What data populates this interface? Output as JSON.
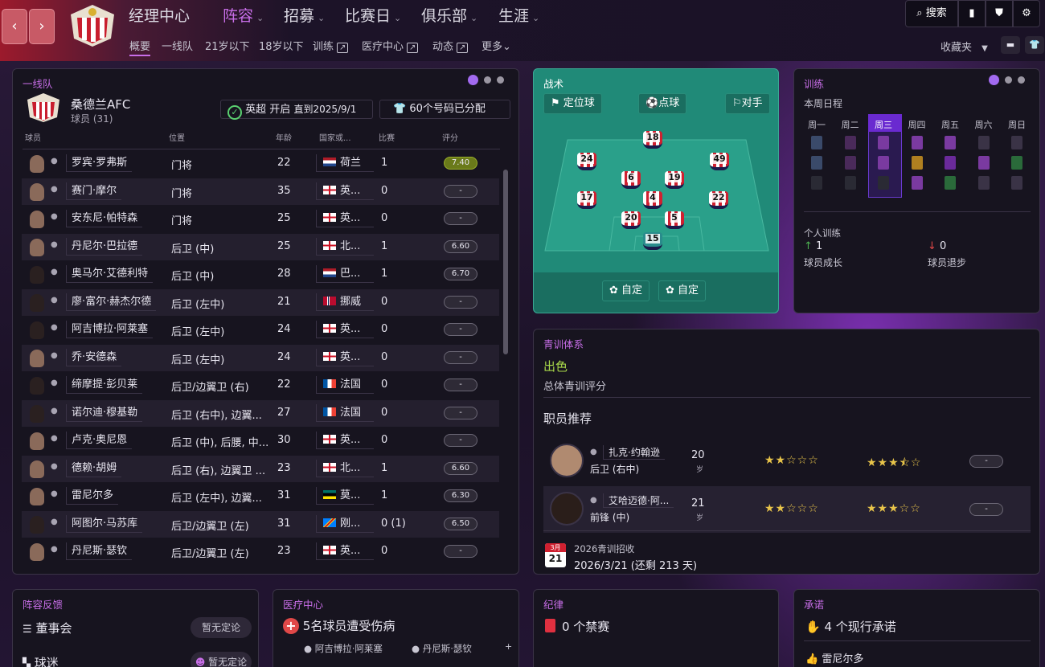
{
  "colors": {
    "accent": "#c86ee8",
    "tactics_bg": "#208a78",
    "positive": "#4caf50",
    "negative": "#e04848"
  },
  "nav": {
    "main": [
      {
        "label": "经理中心"
      },
      {
        "label": "阵容",
        "active": true
      },
      {
        "label": "招募"
      },
      {
        "label": "比赛日"
      },
      {
        "label": "俱乐部"
      },
      {
        "label": "生涯"
      }
    ],
    "sub": [
      {
        "label": "概要",
        "active": true
      },
      {
        "label": "一线队"
      },
      {
        "label": "21岁以下"
      },
      {
        "label": "18岁以下"
      },
      {
        "label": "训练",
        "ext": true
      },
      {
        "label": "医疗中心",
        "ext": true
      },
      {
        "label": "动态",
        "ext": true
      },
      {
        "label": "更多"
      }
    ],
    "search": "搜索",
    "favorites": "收藏夹"
  },
  "squad": {
    "title": "一线队",
    "club": "桑德兰AFC",
    "count": "球员 (31)",
    "league": "英超",
    "status": "开启",
    "until": "直到2025/9/1",
    "numbers": "60个号码已分配",
    "headers": {
      "player": "球员",
      "position": "位置",
      "age": "年龄",
      "nation": "国家或...",
      "apps": "比赛",
      "rating": "评分"
    },
    "players": [
      {
        "name": "罗宾·罗弗斯",
        "pos": "门将",
        "age": "22",
        "nation": "荷兰",
        "flag": "nl",
        "apps": "1",
        "rating": "7.40",
        "green": true
      },
      {
        "name": "赛门·摩尔",
        "pos": "门将",
        "age": "35",
        "nation": "英...",
        "flag": "en",
        "apps": "0",
        "rating": "-"
      },
      {
        "name": "安东尼·帕特森",
        "pos": "门将",
        "age": "25",
        "nation": "英...",
        "flag": "en",
        "apps": "0",
        "rating": "-"
      },
      {
        "name": "丹尼尔·巴拉德",
        "pos": "后卫 (中)",
        "age": "25",
        "nation": "北...",
        "flag": "en",
        "apps": "1",
        "rating": "6.60"
      },
      {
        "name": "奥马尔·艾德利特",
        "pos": "后卫 (中)",
        "age": "28",
        "nation": "巴...",
        "flag": "nl",
        "apps": "1",
        "rating": "6.70",
        "dark": true
      },
      {
        "name": "廖·富尔·赫杰尔德",
        "pos": "后卫 (左中)",
        "age": "21",
        "nation": "挪威",
        "flag": "no",
        "apps": "0",
        "rating": "-",
        "dark": true
      },
      {
        "name": "阿吉博拉·阿莱塞",
        "pos": "后卫 (左中)",
        "age": "24",
        "nation": "英...",
        "flag": "en",
        "apps": "0",
        "rating": "-",
        "dark": true
      },
      {
        "name": "乔·安德森",
        "pos": "后卫 (左中)",
        "age": "24",
        "nation": "英...",
        "flag": "en",
        "apps": "0",
        "rating": "-"
      },
      {
        "name": "缔摩提·彭贝莱",
        "pos": "后卫/边翼卫 (右)",
        "age": "22",
        "nation": "法国",
        "flag": "fr",
        "apps": "0",
        "rating": "-",
        "dark": true
      },
      {
        "name": "诺尔迪·穆基勒",
        "pos": "后卫 (右中), 边翼...",
        "age": "27",
        "nation": "法国",
        "flag": "fr",
        "apps": "0",
        "rating": "-",
        "dark": true
      },
      {
        "name": "卢克·奥尼恩",
        "pos": "后卫 (中), 后腰, 中...",
        "age": "30",
        "nation": "英...",
        "flag": "en",
        "apps": "0",
        "rating": "-"
      },
      {
        "name": "德赖·胡姆",
        "pos": "后卫 (右), 边翼卫 ...",
        "age": "23",
        "nation": "北...",
        "flag": "en",
        "apps": "1",
        "rating": "6.60"
      },
      {
        "name": "雷尼尔多",
        "pos": "后卫 (左中), 边翼...",
        "age": "31",
        "nation": "莫...",
        "flag": "mz",
        "apps": "1",
        "rating": "6.30"
      },
      {
        "name": "阿图尔·马苏库",
        "pos": "后卫/边翼卫 (左)",
        "age": "31",
        "nation": "刚...",
        "flag": "cd",
        "apps": "0 (1)",
        "rating": "6.50",
        "dark": true
      },
      {
        "name": "丹尼斯·瑟钦",
        "pos": "后卫/边翼卫 (左)",
        "age": "23",
        "nation": "英...",
        "flag": "en",
        "apps": "0",
        "rating": "-"
      }
    ]
  },
  "tactics": {
    "title": "战术",
    "set_pieces": "定位球",
    "dead_ball": "点球",
    "opposition": "对手",
    "custom1": "自定",
    "custom2": "自定",
    "shirts": [
      "18",
      "24",
      "49",
      "6",
      "19",
      "17",
      "4",
      "22",
      "20",
      "5",
      "15"
    ]
  },
  "training": {
    "title": "训练",
    "schedule": "本周日程",
    "days": [
      "周一",
      "周二",
      "周三",
      "周四",
      "周五",
      "周六",
      "周日"
    ],
    "individual": "个人训练",
    "growth_count": "1",
    "growth_label": "球员成长",
    "decline_count": "0",
    "decline_label": "球员退步"
  },
  "youth": {
    "title": "青训体系",
    "rating": "出色",
    "rating_label": "总体青训评分",
    "staff_title": "职员推荐",
    "recs": [
      {
        "name": "扎克·约翰逊",
        "pos": "后卫 (右中)",
        "age": "20",
        "unit": "岁",
        "stars1": "★★☆☆☆",
        "stars2": "★★★⯪☆",
        "val": "-"
      },
      {
        "name": "艾哈迈德·阿...",
        "pos": "前锋 (中)",
        "age": "21",
        "unit": "岁",
        "stars1": "★★☆☆☆",
        "stars2": "★★★☆☆",
        "val": "-"
      }
    ],
    "intake_title": "2026青训招收",
    "intake_date": "2026/3/21 (还剩 213 天)",
    "cal_month": "3月",
    "cal_day": "21"
  },
  "feedback": {
    "title": "阵容反馈",
    "board": "董事会",
    "board_val": "暂无定论",
    "fans": "球迷",
    "fans_val": "暂无定论"
  },
  "medical": {
    "title": "医疗中心",
    "injuries": "5名球员遭受伤病",
    "p1": "阿吉博拉·阿莱塞",
    "p2": "丹尼斯·瑟钦",
    "more": "+"
  },
  "discipline": {
    "title": "纪律",
    "bans": "0 个禁赛"
  },
  "promises": {
    "title": "承诺",
    "active": "4 个现行承诺",
    "player": "雷尼尔多"
  }
}
